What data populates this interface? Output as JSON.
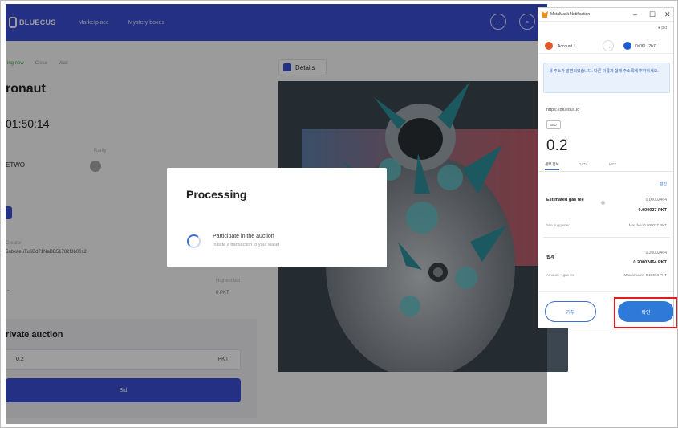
{
  "app": {
    "logo": "BLUECUS",
    "nav": [
      "Marketplace",
      "Mystery boxes"
    ],
    "topbar_icons": [
      "more-icon",
      "search-icon"
    ],
    "breadcrumb": [
      "ing now",
      "Close",
      "Wait"
    ],
    "title": "ronaut",
    "timer": "01:50:14",
    "network_label": "Rarity",
    "network_value": "ETWO",
    "owner_label": "Creator",
    "address": "5abxaeuTu6Bd71NaBB51782f8b00s2",
    "dash": "-",
    "price_label": "Highest bid",
    "price_value": "0 PKT",
    "auction_title": "rivate auction",
    "bid_value": "0.2",
    "bid_unit": "PKT",
    "bid_button": "Bid",
    "details_tab": "Details"
  },
  "modal": {
    "title": "Processing",
    "step_title": "Participate in the auction",
    "step_sub": "Initiate a transaction to your wallet"
  },
  "metamask": {
    "window_title": "MetaMask Notification",
    "controls": [
      "–",
      "☐",
      "✕"
    ],
    "network": "● pkt",
    "account_from": "Account 1",
    "account_to": "0x0f0...2b7f",
    "notice": "새 주소가 발견되었습니다. 다른 이름과 함께 주소록에 추가하세요.",
    "origin": "https://bluecus.io",
    "badge": "BID",
    "amount": "0.2",
    "tabs": [
      "세부 정보",
      "DATA",
      "HEX"
    ],
    "edit": "편집",
    "gas_label": "Estimated gas fee",
    "gas_estimate": "0.00002464",
    "gas_bold": "0.000027 PKT",
    "gas_site": "Site suggested",
    "gas_max": "Max fee: 0.000037 PKT",
    "total_label": "합계",
    "total_estimate": "0.20002464",
    "total_bold": "0.20002464 PKT",
    "total_sub": "Amount + gas fee",
    "total_max": "Max amount: 0.20003 PKT",
    "cancel": "거부",
    "confirm": "확인"
  }
}
